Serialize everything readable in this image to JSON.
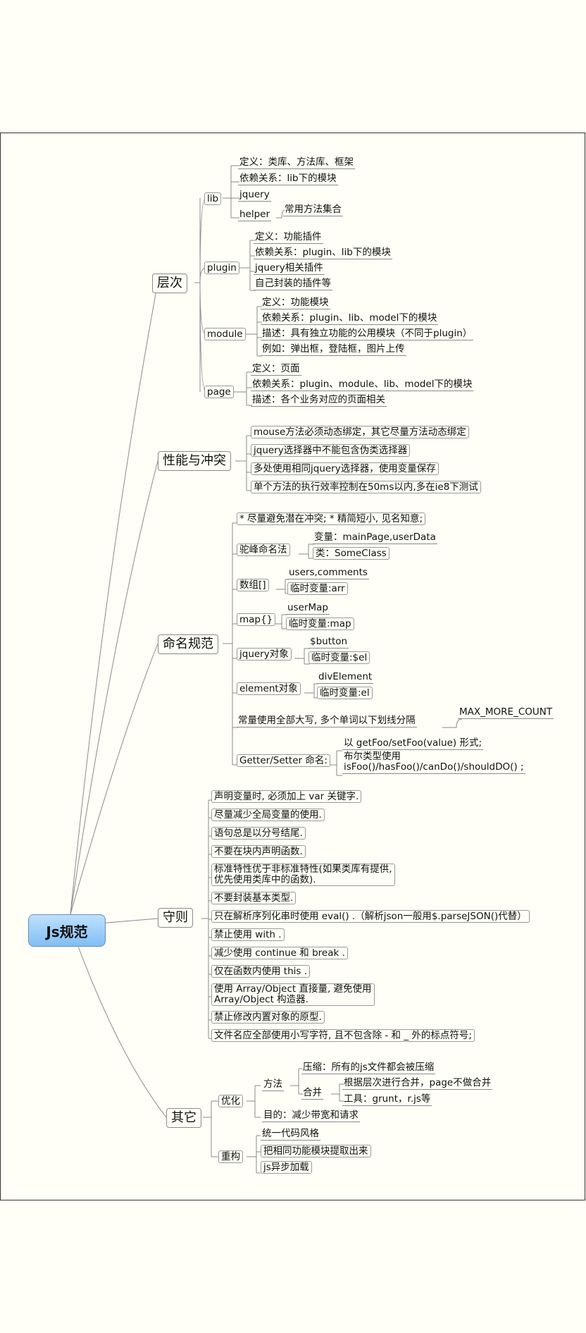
{
  "root": "Js规范",
  "cengci": {
    "label": "层次",
    "lib": {
      "label": "lib",
      "items": [
        "定义：类库、方法库、框架",
        "依赖关系：lib下的模块",
        "jquery",
        "helper",
        "常用方法集合"
      ]
    },
    "plugin": {
      "label": "plugin",
      "items": [
        "定义：功能插件",
        "依赖关系：plugin、lib下的模块",
        "jquery相关插件",
        "自己封装的插件等"
      ]
    },
    "module": {
      "label": "module",
      "items": [
        "定义：功能模块",
        "依赖关系：plugin、lib、model下的模块",
        "描述：具有独立功能的公用模块（不同于plugin）",
        "例如：弹出框，登陆框，图片上传"
      ]
    },
    "page": {
      "label": "page",
      "items": [
        "定义：页面",
        "依赖关系：plugin、module、lib、model下的模块",
        "描述：各个业务对应的页面相关"
      ]
    }
  },
  "xingneng": {
    "label": "性能与冲突",
    "items": [
      "mouse方法必须动态绑定，其它尽量方法动态绑定",
      "jquery选择器中不能包含伪类选择器",
      "多处使用相同jquery选择器，使用变量保存",
      "单个方法的执行效率控制在50ms以内,多在ie8下测试"
    ]
  },
  "mingming": {
    "label": "命名规范",
    "items": [
      "* 尽量避免潜在冲突; * 精简短小, 见名知意;",
      "驼峰命名法",
      "变量：mainPage,userData",
      "类：SomeClass",
      "数组[]",
      "users,comments",
      "临时变量:arr",
      "map{}",
      "userMap",
      "临时变量:map",
      "jquery对象",
      "$button",
      "临时变量:$el",
      "element对象",
      "divElement",
      "临时变量:el",
      "常量使用全部大写, 多个单词以下划线分隔",
      "MAX_MORE_COUNT",
      "Getter/Setter 命名:",
      "以 getFoo/setFoo(value) 形式;",
      "布尔类型使用",
      "isFoo()/hasFoo()/canDo()/shouldDO() ;"
    ]
  },
  "shouze": {
    "label": "守则",
    "items": [
      "声明变量时, 必须加上 var 关键字.",
      "尽量减少全局变量的使用.",
      "语句总是以分号结尾.",
      "不要在块内声明函数.",
      "标准特性优于非标准特性(如果类库有提供,",
      "优先使用类库中的函数).",
      "不要封装基本类型.",
      "只在解析序列化串时使用 eval() .（解析json一般用$.parseJSON()代替）",
      "禁止使用 with .",
      "减少使用 continue 和 break .",
      "仅在函数内使用 this .",
      "使用 Array/Object 直接量, 避免使用",
      "Array/Object 构造器.",
      "禁止修改内置对象的原型.",
      "文件名应全部使用小写字符, 且不包含除 - 和 _ 外的标点符号;"
    ]
  },
  "qita": {
    "label": "其它",
    "youhua": {
      "label": "优化",
      "fangfa": "方法",
      "items": [
        "压缩：所有的js文件都会被压缩",
        "合并",
        "根据层次进行合并，page不做合并",
        "工具：grunt，r.js等",
        "目的：减少带宽和请求"
      ]
    },
    "chonggou": {
      "label": "重构",
      "items": [
        "统一代码风格",
        "把相同功能模块提取出来",
        "js异步加载"
      ]
    }
  },
  "colors": {
    "root_top": "#bfe0ff",
    "root_bottom": "#80bff2",
    "line": "#8a8a8a",
    "background": "#fffff8"
  }
}
